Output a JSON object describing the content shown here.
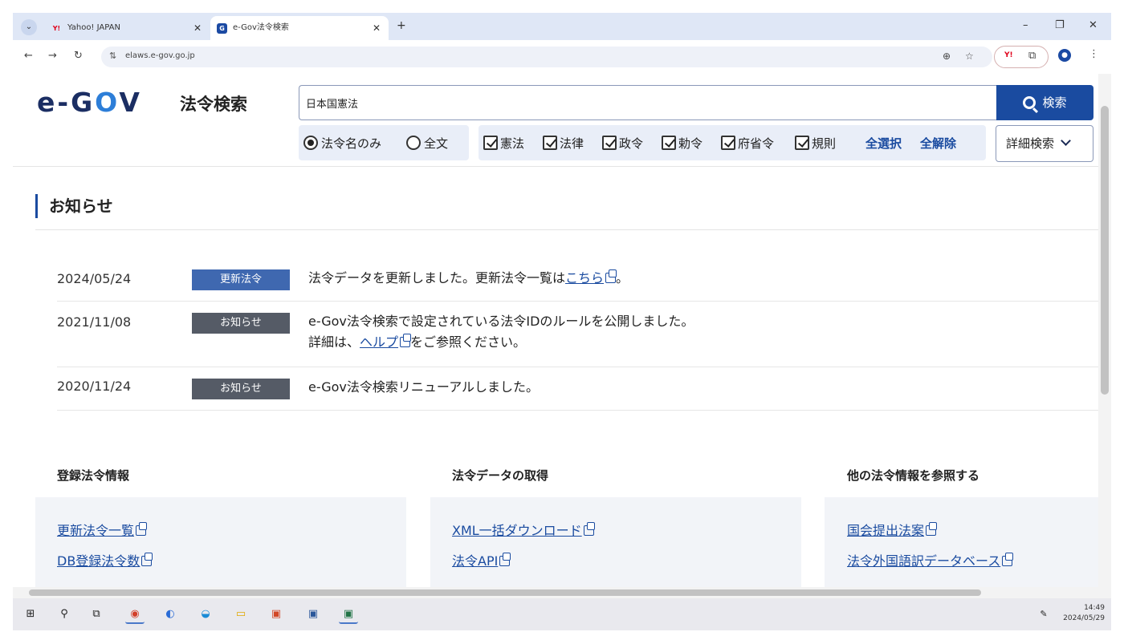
{
  "browser": {
    "tabs": [
      {
        "favicon": "Y!",
        "title": "Yahoo! JAPAN"
      },
      {
        "favicon": "G",
        "title": "e-Gov法令検索"
      }
    ],
    "url": "elaws.e-gov.go.jp"
  },
  "header": {
    "logo_main": "e-G",
    "logo_accent": "O",
    "logo_end": "V",
    "title": "法令検索",
    "search_value": "日本国憲法",
    "search_button": "検索",
    "scope_options": [
      "法令名のみ",
      "全文"
    ],
    "type_options": [
      "憲法",
      "法律",
      "政令",
      "勅令",
      "府省令",
      "規則"
    ],
    "select_all": "全選択",
    "clear_all": "全解除",
    "detail_search": "詳細検索"
  },
  "notices": {
    "title": "お知らせ",
    "items": [
      {
        "date": "2024/05/24",
        "badge": "更新法令",
        "text": "法令データを更新しました。更新法令一覧は",
        "link": "こちら",
        "tail": "。"
      },
      {
        "date": "2021/11/08",
        "badge": "お知らせ",
        "text": "e-Gov法令検索で設定されている法令IDのルールを公開しました。",
        "text2": "詳細は、",
        "link": "ヘルプ",
        "tail": "をご参照ください。"
      },
      {
        "date": "2020/11/24",
        "badge": "お知らせ",
        "text": "e-Gov法令検索リニューアルしました。"
      }
    ]
  },
  "columns": [
    {
      "heading": "登録法令情報",
      "links": [
        "更新法令一覧",
        "DB登録法令数"
      ]
    },
    {
      "heading": "法令データの取得",
      "links": [
        "XML一括ダウンロード",
        "法令API"
      ]
    },
    {
      "heading": "他の法令情報を参照する",
      "links": [
        "国会提出法案",
        "法令外国語訳データベース"
      ]
    }
  ],
  "taskbar": {
    "time": "14:49",
    "date": "2024/05/29"
  }
}
